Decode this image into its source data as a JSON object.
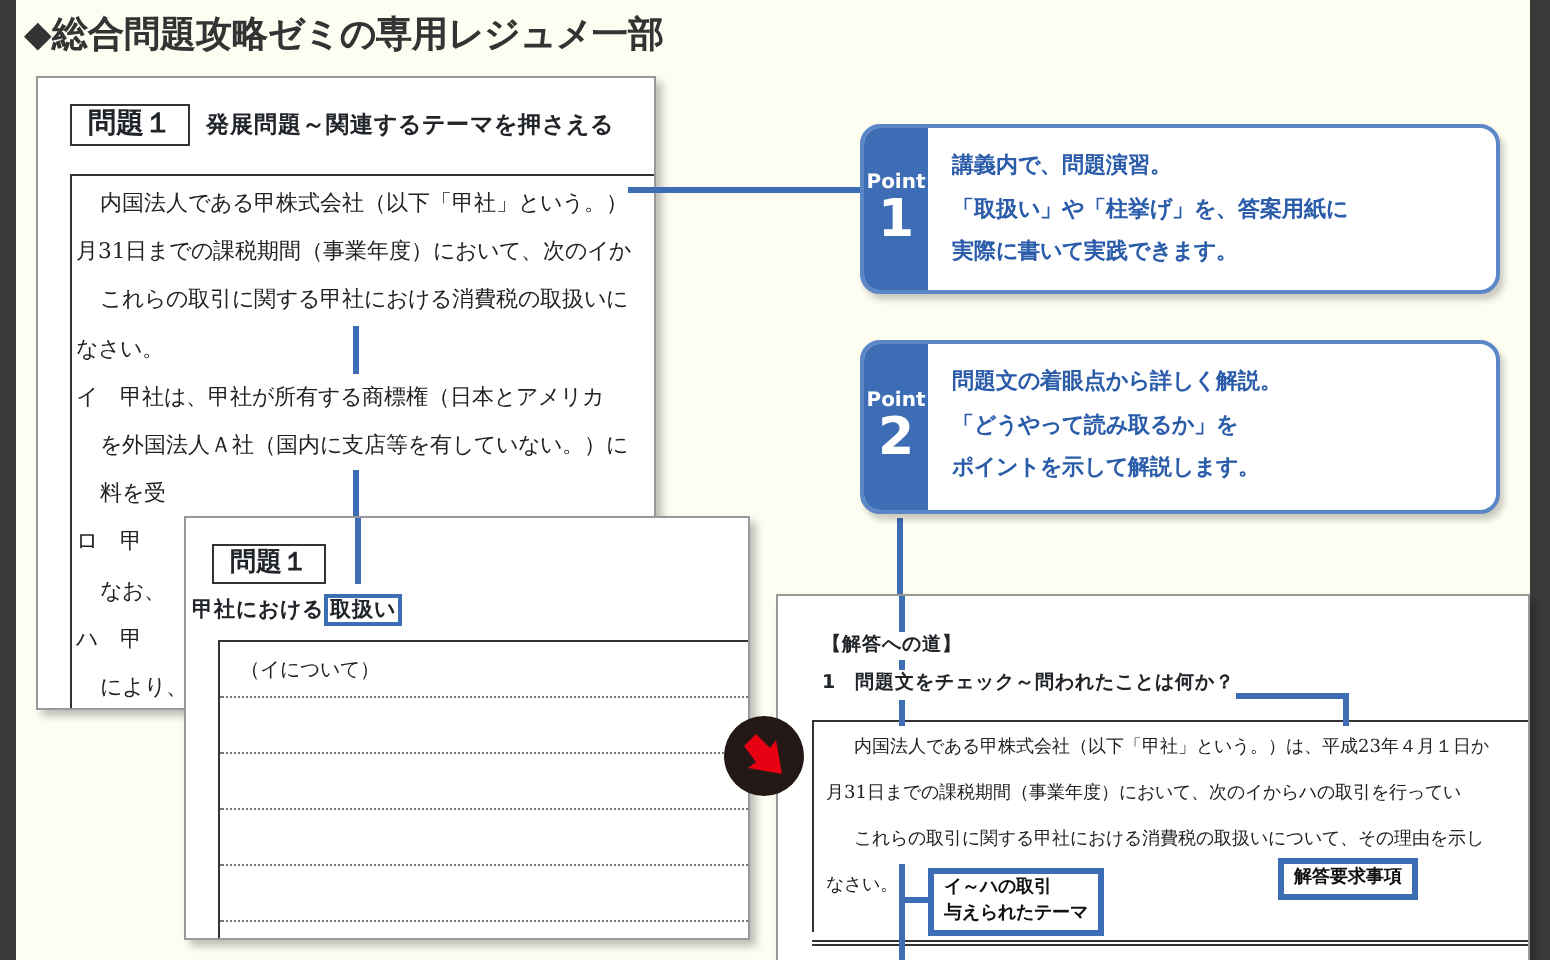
{
  "page_title": "◆総合問題攻略ゼミの専用レジュメ一部",
  "problem_sheet": {
    "badge": "問題１",
    "heading": "発展問題～関連するテーマを押さえる",
    "lines": [
      {
        "text": "内国法人である甲株式会社（以下「甲社」という。）",
        "indent": true
      },
      {
        "text": "月31日までの課税期間（事業年度）において、次のイか",
        "indent": false
      },
      {
        "text": "これらの取引に関する甲社における消費税の取扱いに",
        "indent": true
      },
      {
        "text": "なさい。",
        "indent": false
      },
      {
        "text": "イ　甲社は、甲社が所有する商標権（日本とアメリカ",
        "indent": false
      },
      {
        "text": "を外国法人Ａ社（国内に支店等を有していない。）に",
        "indent": true
      },
      {
        "text": "料を受",
        "indent": true
      },
      {
        "text": "ロ　甲",
        "indent": false
      },
      {
        "text": "なお、",
        "indent": true
      },
      {
        "text": "ハ　甲",
        "indent": false
      },
      {
        "text": "により、",
        "indent": true
      }
    ]
  },
  "answer_sheet": {
    "badge": "問題１",
    "prompt": "甲社における",
    "prompt_highlight": "取扱い",
    "answer_label": "（イについて）"
  },
  "points": [
    {
      "label": "Point",
      "number": "1",
      "lines": [
        "講義内で、問題演習。",
        "「取扱い」や「柱挙げ」を、答案用紙に",
        "実際に書いて実践できます。"
      ]
    },
    {
      "label": "Point",
      "number": "2",
      "lines": [
        "問題文の着眼点から詳しく解説。",
        "「どうやって読み取るか」を",
        "ポイントを示して解説します。"
      ]
    }
  ],
  "solution_sheet": {
    "heading": "【解答への道】",
    "subheading": "1　問題文をチェック～問われたことは何か？",
    "lines": [
      {
        "text": "内国法人である甲株式会社（以下「甲社」という。）は、平成23年４月１日か",
        "indent": true
      },
      {
        "text": "月31日までの課税期間（事業年度）において、次のイからハの取引を行ってい",
        "indent": false
      },
      {
        "text": "これらの取引に関する甲社における消費税の取扱いについて、その理由を示し",
        "indent": true
      },
      {
        "text": "なさい。",
        "indent": false
      }
    ],
    "callouts": [
      {
        "lines": [
          "解答要求事項"
        ]
      },
      {
        "lines": [
          "イ～ハの取引",
          "与えられたテーマ"
        ]
      }
    ]
  }
}
